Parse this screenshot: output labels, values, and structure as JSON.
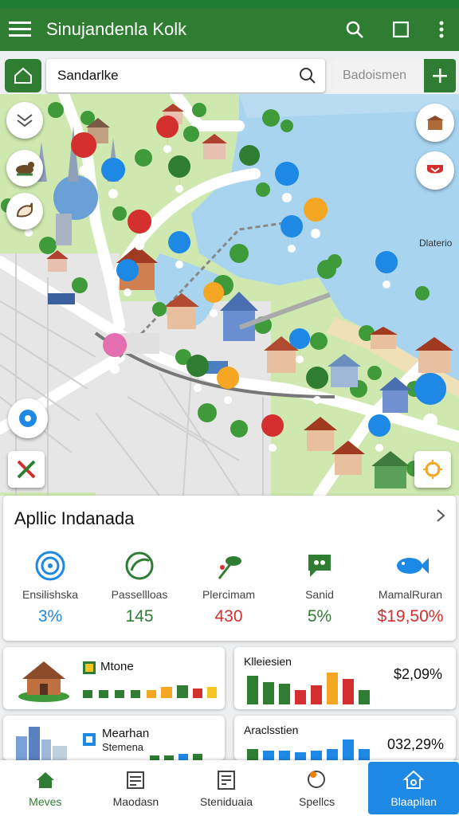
{
  "app": {
    "title": "Sinujandenla Kolk",
    "colors": {
      "primary": "#2e7d32",
      "accent": "#1e88e5",
      "danger": "#d32f2f"
    }
  },
  "search": {
    "value": "Sandarlke",
    "secondary_placeholder": "Badoismen"
  },
  "map": {
    "label_right": "Dlaterio"
  },
  "summary": {
    "title": "Apllic Indanada",
    "stats": [
      {
        "label": "Ensilishska",
        "value": "3%",
        "icon": "swirl-icon",
        "color": "#1e88e5"
      },
      {
        "label": "Passellloas",
        "value": "145",
        "icon": "leaf-badge-icon",
        "color": "#2e7d32"
      },
      {
        "label": "Plercimam",
        "value": "430",
        "icon": "sprout-icon",
        "color": "#d32f2f"
      },
      {
        "label": "Sanid",
        "value": "5%",
        "icon": "chat-bubble-icon",
        "color": "#2e7d32"
      },
      {
        "label": "MamalRuran",
        "value": "$19,50%",
        "icon": "fish-icon",
        "color": "#d32f2f"
      }
    ]
  },
  "cards": [
    {
      "name": "Mtone",
      "sub": "",
      "pct": ""
    },
    {
      "name": "Klleiesien",
      "sub": "",
      "pct": "$2,09%"
    },
    {
      "name": "Mearhan",
      "sub": "Stemena",
      "pct": ""
    },
    {
      "name": "Araclsstien",
      "sub": "",
      "pct": "032,29%"
    }
  ],
  "bottom_nav": [
    {
      "label": "Meves",
      "icon": "home-icon"
    },
    {
      "label": "Maodasn",
      "icon": "book-icon"
    },
    {
      "label": "Steniduaia",
      "icon": "calendar-icon"
    },
    {
      "label": "Spellcs",
      "icon": "search-icon"
    },
    {
      "label": "Blaapilan",
      "icon": "house-outline-icon"
    }
  ]
}
